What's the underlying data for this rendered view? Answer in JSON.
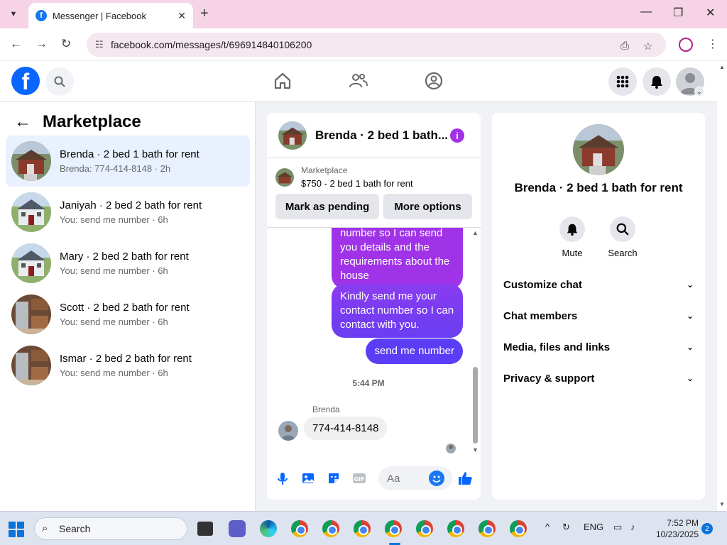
{
  "browser": {
    "tab_title": "Messenger | Facebook",
    "tab_favicon": "f",
    "url": "facebook.com/messages/t/696914840106200"
  },
  "left_pane": {
    "title": "Marketplace",
    "conversations": [
      {
        "name": "Brenda · 2 bed 1 bath for rent",
        "preview": "Brenda: 774-414-8148 · 2h",
        "active": true
      },
      {
        "name": "Janiyah · 2 bed 2 bath for rent",
        "preview": "You: send me number · 6h",
        "active": false
      },
      {
        "name": "Mary · 2 bed 2 bath for rent",
        "preview": "You: send me number · 6h",
        "active": false
      },
      {
        "name": "Scott · 2 bed 2 bath for rent",
        "preview": "You: send me number · 6h",
        "active": false
      },
      {
        "name": "Ismar · 2 bed 2 bath for rent",
        "preview": "You: send me number · 6h",
        "active": false
      }
    ]
  },
  "chat": {
    "title": "Brenda · 2 bed 1 bath...",
    "listing_category": "Marketplace",
    "listing_price": "$750 - 2 bed 1 bath for rent",
    "mark_pending_label": "Mark as pending",
    "more_options_label": "More options",
    "messages_out": [
      "number so I can send you details and the requirements about the house",
      "Kindly send me your contact number so I can contact with you.",
      "send me number"
    ],
    "timestamp": "5:44 PM",
    "incoming_sender": "Brenda",
    "incoming_message": "774-414-8148",
    "composer_placeholder": "Aa"
  },
  "right_pane": {
    "title": "Brenda · 2 bed 1 bath for rent",
    "mute_label": "Mute",
    "search_label": "Search",
    "sections": [
      "Customize chat",
      "Chat members",
      "Media, files and links",
      "Privacy & support"
    ]
  },
  "taskbar": {
    "search_label": "Search",
    "language": "ENG",
    "time": "7:52 PM",
    "date": "10/23/2025",
    "notification_count": "2"
  },
  "colors": {
    "fb_blue": "#0866ff",
    "bubble_purple": "#a033e8",
    "bubble_indigo": "#5b3df5",
    "active_row": "#e8f1fd"
  }
}
